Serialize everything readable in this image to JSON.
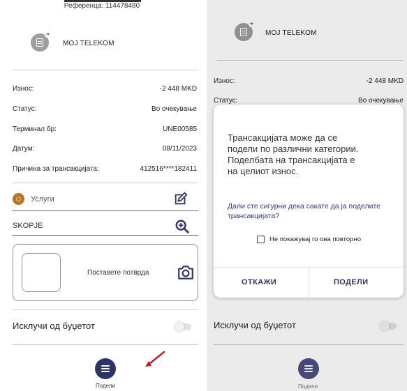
{
  "left": {
    "reference": "Референца: 114478480",
    "merchant": "MOJ TELEKOM",
    "details": [
      {
        "label": "Износ:",
        "value": "-2 448 MKD"
      },
      {
        "label": "Статус:",
        "value": "Во очекување"
      },
      {
        "label": "Терминал бр:",
        "value": "UNE00585"
      },
      {
        "label": "Датум:",
        "value": "08/11/2023"
      },
      {
        "label": "Причина за трансакцијата:",
        "value": "412516****182411"
      }
    ],
    "category": "Услуги",
    "city": "SKOPJE",
    "receipt_label": "Поставете потврда",
    "exclude_label": "Исклучи од буџетот",
    "fab_label": "Подели",
    "exclude_toggle_on": false
  },
  "right": {
    "merchant": "MOJ TELEKOM",
    "details": [
      {
        "label": "Износ:",
        "value": "-2 448 MKD"
      },
      {
        "label": "Статус:",
        "value": "Во очекување"
      }
    ],
    "exclude_label": "Исклучи од буџетот",
    "fab_label": "Подели",
    "dialog": {
      "message": "Трансакцијата може да се подели по различни категории. Поделбата на трансакцијата е на целиот износ.",
      "question": "Дали сте сигурни дека сакате да ја поделите трансакцијата?",
      "checkbox_label": "Не покажувај го ова повторно",
      "checkbox_checked": false,
      "cancel": "ОТКАЖИ",
      "confirm": "ПОДЕЛИ"
    }
  },
  "colors": {
    "primary": "#2c3566",
    "category_icon": "#b67429",
    "annotation_arrow": "#c0201d",
    "question_text": "#2c3a8c"
  }
}
